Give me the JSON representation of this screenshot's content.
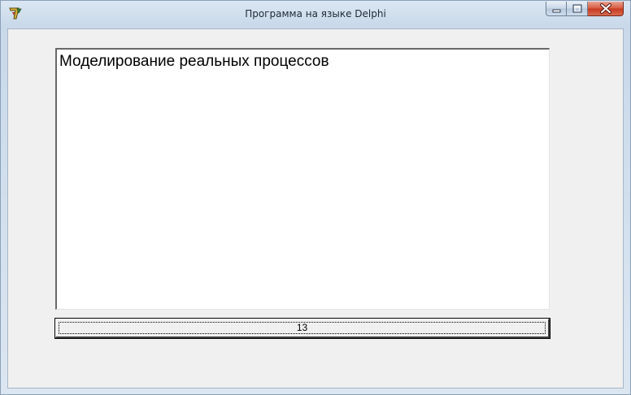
{
  "window": {
    "title": "Программа на языке Delphi",
    "icon": "delphi-app-icon",
    "controls": {
      "minimize": "minimize-icon",
      "maximize": "maximize-icon",
      "close": "close-icon"
    }
  },
  "memo": {
    "text": "Моделирование реальных процессов"
  },
  "button": {
    "label": "13"
  },
  "colors": {
    "client_background": "#f0f0f0",
    "memo_background": "#ffffff",
    "close_button": "#c73a20"
  }
}
